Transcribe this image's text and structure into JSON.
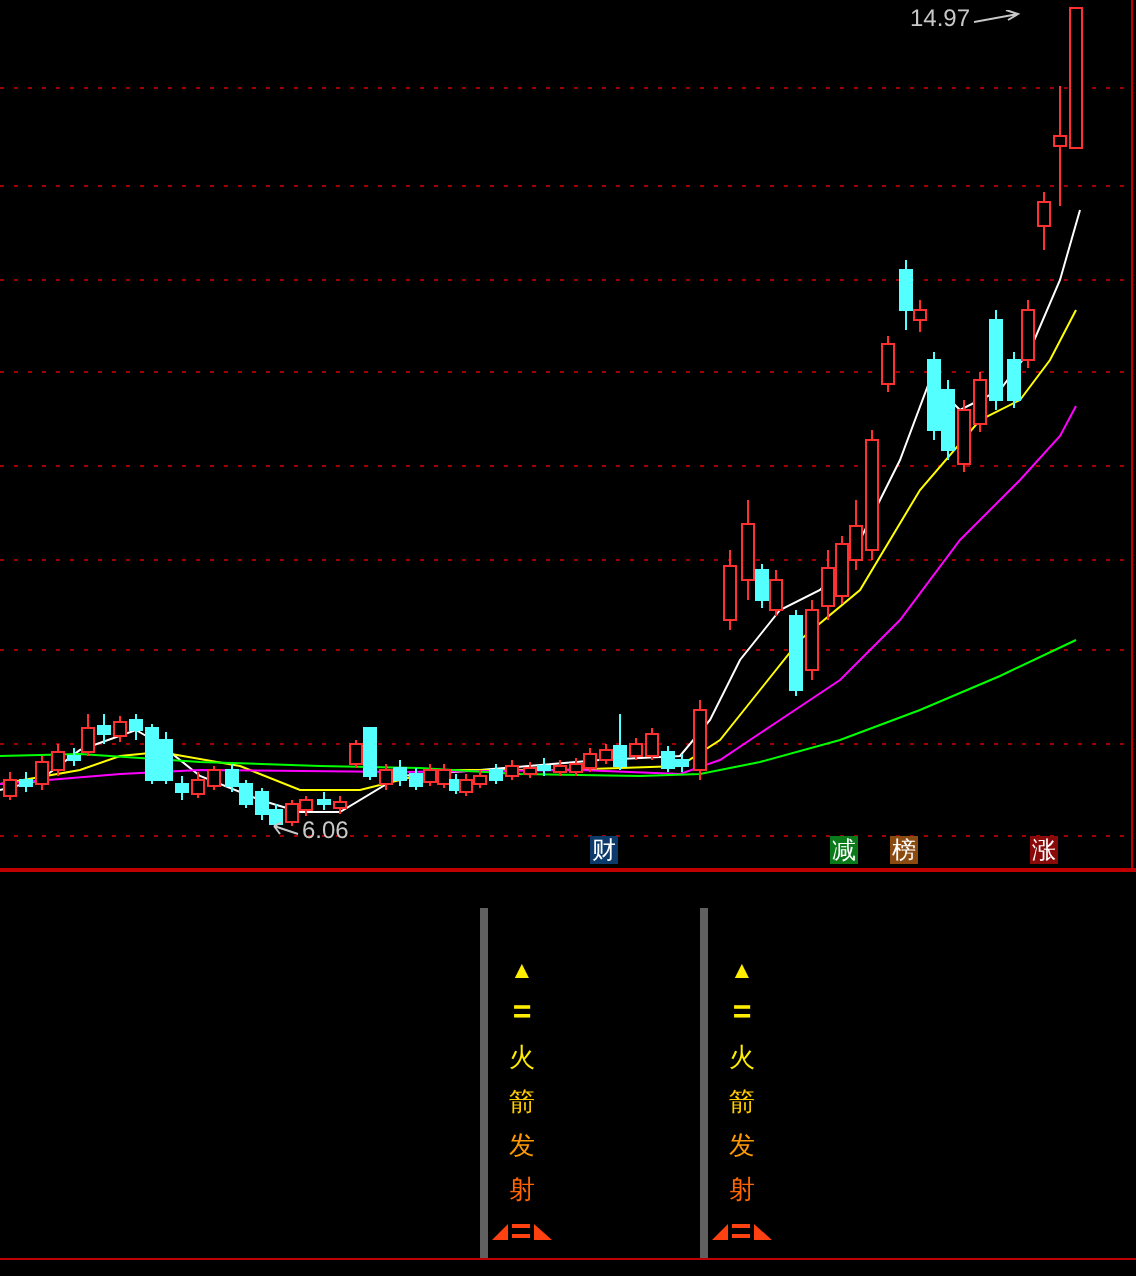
{
  "price_chart": {
    "high_label": "14.97",
    "low_label": "6.06",
    "badges": [
      {
        "text": "财",
        "color": "#0b3a6b"
      },
      {
        "text": "减",
        "color": "#0a7a1a"
      },
      {
        "text": "榜",
        "color": "#8a4a10"
      },
      {
        "text": "涨",
        "color": "#8a0a0a"
      }
    ]
  },
  "signal_panel": {
    "columns": [
      {
        "arrow": "▲",
        "equals": "=",
        "chars": [
          "火",
          "箭",
          "发",
          "射"
        ]
      },
      {
        "arrow": "▲",
        "equals": "=",
        "chars": [
          "火",
          "箭",
          "发",
          "射"
        ]
      }
    ]
  }
}
